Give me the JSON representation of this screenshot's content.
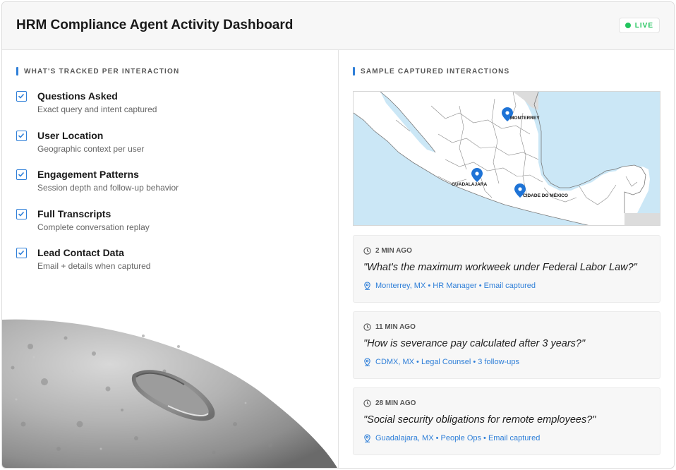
{
  "header": {
    "title": "HRM Compliance Agent Activity Dashboard",
    "live_label": "LIVE",
    "live_color": "#22c55e"
  },
  "tracked": {
    "section_label": "WHAT'S TRACKED PER INTERACTION",
    "items": [
      {
        "title": "Questions Asked",
        "description": "Exact query and intent captured"
      },
      {
        "title": "User Location",
        "description": "Geographic context per user"
      },
      {
        "title": "Engagement Patterns",
        "description": "Session depth and follow-up behavior"
      },
      {
        "title": "Full Transcripts",
        "description": "Complete conversation replay"
      },
      {
        "title": "Lead Contact Data",
        "description": "Email + details when captured"
      }
    ]
  },
  "samples": {
    "section_label": "SAMPLE CAPTURED INTERACTIONS",
    "map": {
      "pins": [
        {
          "label": "MONTERREY"
        },
        {
          "label": "GUADALAJARA"
        },
        {
          "label": "CIDADE DO MÉXICO"
        }
      ]
    },
    "interactions": [
      {
        "time": "2 MIN AGO",
        "quote": "\"What's the maximum workweek under Federal Labor Law?\"",
        "meta": "Monterrey, MX • HR Manager • Email captured"
      },
      {
        "time": "11 MIN AGO",
        "quote": "\"How is severance pay calculated after 3 years?\"",
        "meta": "CDMX, MX • Legal Counsel • 3 follow-ups"
      },
      {
        "time": "28 MIN AGO",
        "quote": "\"Social security obligations for remote employees?\"",
        "meta": "Guadalajara, MX • People Ops • Email captured"
      }
    ]
  },
  "colors": {
    "accent": "#2f7fd8",
    "pin": "#1e73d6",
    "water": "#cbe7f6",
    "land": "#ffffff"
  },
  "icons": [
    "checkbox-icon",
    "clock-icon",
    "location-pin-icon",
    "map-pin-icon"
  ]
}
